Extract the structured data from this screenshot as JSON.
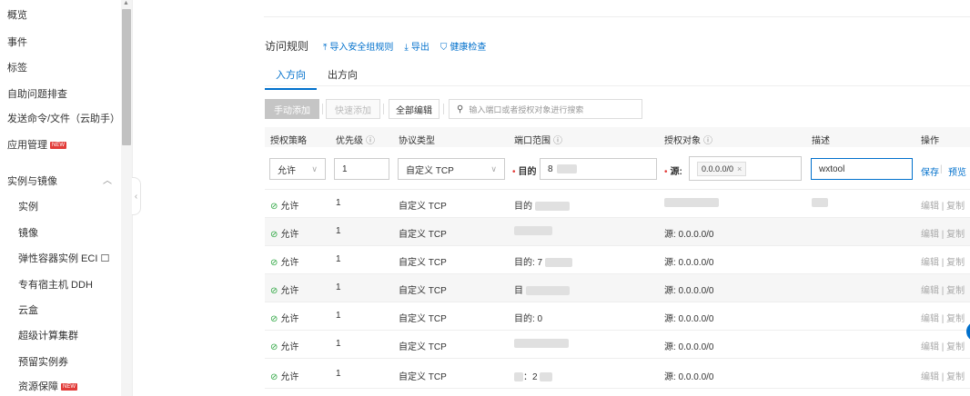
{
  "sidebar": {
    "items": [
      {
        "label": "概览"
      },
      {
        "label": "事件"
      },
      {
        "label": "标签"
      },
      {
        "label": "自助问题排查"
      },
      {
        "label": "发送命令/文件（云助手）"
      },
      {
        "label": "应用管理",
        "badge": "NEW"
      },
      {
        "label": "实例与镜像"
      },
      {
        "label": "实例"
      },
      {
        "label": "镜像"
      },
      {
        "label": "弹性容器实例 ECI ☐"
      },
      {
        "label": "专有宿主机 DDH"
      },
      {
        "label": "云盒"
      },
      {
        "label": "超级计算集群"
      },
      {
        "label": "预留实例券"
      },
      {
        "label": "资源保障",
        "badge": "NEW"
      }
    ]
  },
  "section": {
    "title": "访问规则",
    "links": [
      {
        "icon": "upload-icon",
        "label": "导入安全组规则"
      },
      {
        "icon": "download-icon",
        "label": "导出"
      },
      {
        "icon": "shield-icon",
        "label": "健康检查"
      }
    ]
  },
  "tabs": [
    {
      "label": "入方向",
      "active": true
    },
    {
      "label": "出方向",
      "active": false
    }
  ],
  "toolbar": {
    "manual_add": "手动添加",
    "quick_add": "快速添加",
    "edit_all": "全部编辑",
    "search_placeholder": "输入端口或者授权对象进行搜索"
  },
  "table": {
    "columns": [
      "授权策略",
      "优先级",
      "协议类型",
      "端口范围",
      "授权对象",
      "描述",
      "操作"
    ],
    "edit_row": {
      "policy": "允许",
      "priority": "1",
      "protocol": "自定义 TCP",
      "port_label": "目的",
      "port_value": "8",
      "source_label": "源:",
      "source_tag": "0.0.0.0/0",
      "description": "wxtool",
      "save": "保存",
      "preview": "预览"
    },
    "rows": [
      {
        "policy": "允许",
        "priority": "1",
        "protocol": "自定义 TCP",
        "port": "目的",
        "source": ""
      },
      {
        "policy": "允许",
        "priority": "1",
        "protocol": "自定义 TCP",
        "port": "",
        "source": "源: 0.0.0.0/0"
      },
      {
        "policy": "允许",
        "priority": "1",
        "protocol": "自定义 TCP",
        "port": "目的: 7",
        "source": "源: 0.0.0.0/0"
      },
      {
        "policy": "允许",
        "priority": "1",
        "protocol": "自定义 TCP",
        "port": "目",
        "source": "源: 0.0.0.0/0"
      },
      {
        "policy": "允许",
        "priority": "1",
        "protocol": "自定义 TCP",
        "port": "目的: 0",
        "source": "源: 0.0.0.0/0"
      },
      {
        "policy": "允许",
        "priority": "1",
        "protocol": "自定义 TCP",
        "port": "",
        "source": "源: 0.0.0.0/0"
      },
      {
        "policy": "允许",
        "priority": "1",
        "protocol": "自定义 TCP",
        "port": "：2",
        "source": "源: 0.0.0.0/0"
      }
    ],
    "op_edit": "编辑",
    "op_copy": "复制"
  }
}
